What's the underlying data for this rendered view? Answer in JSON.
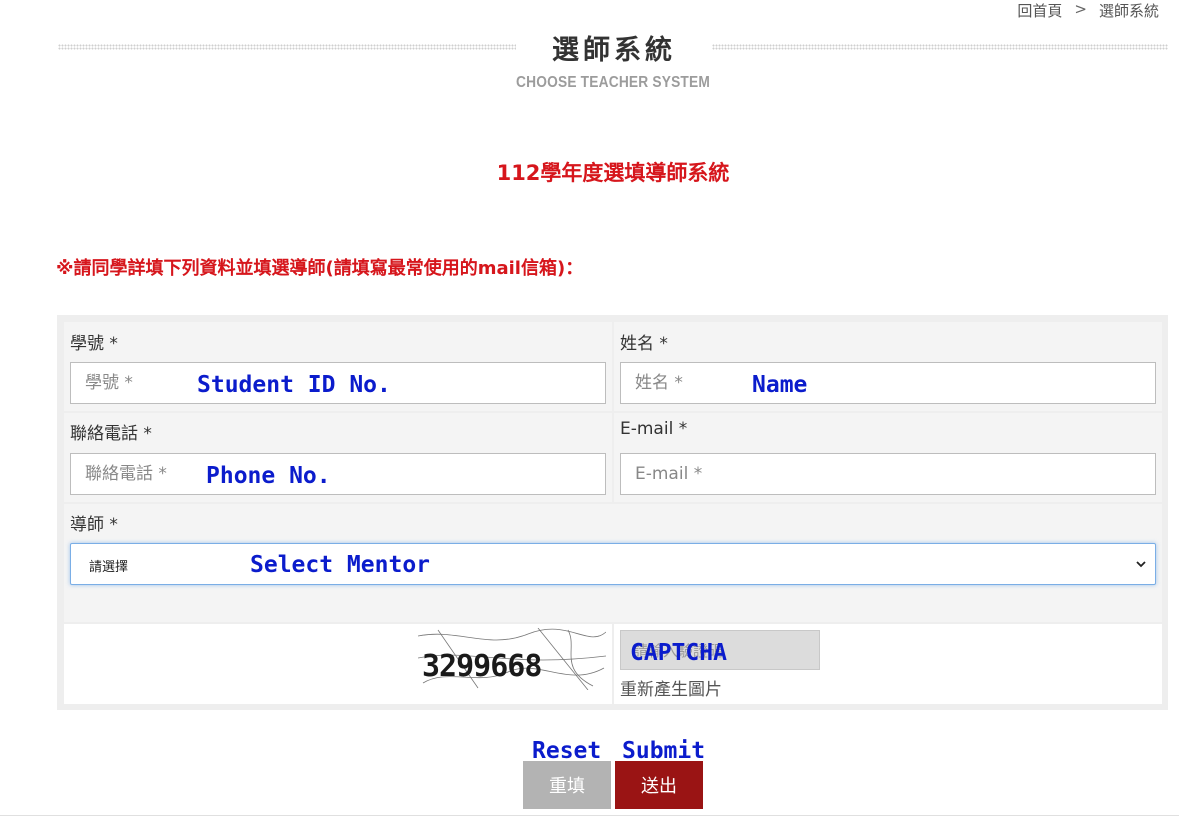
{
  "breadcrumb": {
    "home": "回首頁",
    "separator": ">",
    "current": "選師系統"
  },
  "header": {
    "title": "選師系統",
    "subtitle": "CHOOSE TEACHER SYSTEM"
  },
  "system_title": "112學年度選填導師系統",
  "instruction": "※請同學詳填下列資料並填選導師(請填寫最常使用的mail信箱)：",
  "form": {
    "student_id": {
      "label": "學號 *",
      "placeholder": "學號 *",
      "annotation": "Student ID No."
    },
    "name": {
      "label": "姓名 *",
      "placeholder": "姓名 *",
      "annotation": "Name"
    },
    "phone": {
      "label": "聯絡電話 *",
      "placeholder": "聯絡電話 *",
      "annotation": "Phone No."
    },
    "email": {
      "label": "E-mail *",
      "placeholder": "E-mail *"
    },
    "mentor": {
      "label": "導師 *",
      "selected": "請選擇",
      "annotation": "Select Mentor"
    },
    "captcha": {
      "code": "3299668",
      "placeholder": "請輸入驗證碼",
      "annotation": "CAPTCHA",
      "regenerate": "重新產生圖片"
    }
  },
  "buttons": {
    "reset": {
      "label": "重填",
      "annotation": "Reset"
    },
    "submit": {
      "label": "送出",
      "annotation": "Submit"
    }
  },
  "colors": {
    "accent_red": "#d6161c",
    "submit_bg": "#9a1414",
    "reset_bg": "#b3b3b3",
    "annotation_blue": "#0b1ccc"
  }
}
